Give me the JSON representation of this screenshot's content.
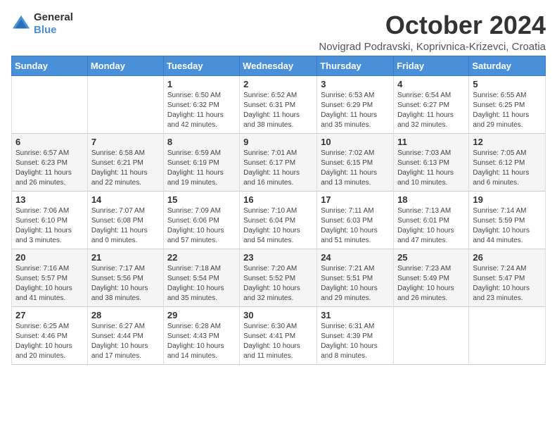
{
  "logo": {
    "general": "General",
    "blue": "Blue"
  },
  "header": {
    "month": "October 2024",
    "location": "Novigrad Podravski, Koprivnica-Krizevci, Croatia"
  },
  "weekdays": [
    "Sunday",
    "Monday",
    "Tuesday",
    "Wednesday",
    "Thursday",
    "Friday",
    "Saturday"
  ],
  "weeks": [
    [
      {
        "day": "",
        "info": ""
      },
      {
        "day": "",
        "info": ""
      },
      {
        "day": "1",
        "info": "Sunrise: 6:50 AM\nSunset: 6:32 PM\nDaylight: 11 hours and 42 minutes."
      },
      {
        "day": "2",
        "info": "Sunrise: 6:52 AM\nSunset: 6:31 PM\nDaylight: 11 hours and 38 minutes."
      },
      {
        "day": "3",
        "info": "Sunrise: 6:53 AM\nSunset: 6:29 PM\nDaylight: 11 hours and 35 minutes."
      },
      {
        "day": "4",
        "info": "Sunrise: 6:54 AM\nSunset: 6:27 PM\nDaylight: 11 hours and 32 minutes."
      },
      {
        "day": "5",
        "info": "Sunrise: 6:55 AM\nSunset: 6:25 PM\nDaylight: 11 hours and 29 minutes."
      }
    ],
    [
      {
        "day": "6",
        "info": "Sunrise: 6:57 AM\nSunset: 6:23 PM\nDaylight: 11 hours and 26 minutes."
      },
      {
        "day": "7",
        "info": "Sunrise: 6:58 AM\nSunset: 6:21 PM\nDaylight: 11 hours and 22 minutes."
      },
      {
        "day": "8",
        "info": "Sunrise: 6:59 AM\nSunset: 6:19 PM\nDaylight: 11 hours and 19 minutes."
      },
      {
        "day": "9",
        "info": "Sunrise: 7:01 AM\nSunset: 6:17 PM\nDaylight: 11 hours and 16 minutes."
      },
      {
        "day": "10",
        "info": "Sunrise: 7:02 AM\nSunset: 6:15 PM\nDaylight: 11 hours and 13 minutes."
      },
      {
        "day": "11",
        "info": "Sunrise: 7:03 AM\nSunset: 6:13 PM\nDaylight: 11 hours and 10 minutes."
      },
      {
        "day": "12",
        "info": "Sunrise: 7:05 AM\nSunset: 6:12 PM\nDaylight: 11 hours and 6 minutes."
      }
    ],
    [
      {
        "day": "13",
        "info": "Sunrise: 7:06 AM\nSunset: 6:10 PM\nDaylight: 11 hours and 3 minutes."
      },
      {
        "day": "14",
        "info": "Sunrise: 7:07 AM\nSunset: 6:08 PM\nDaylight: 11 hours and 0 minutes."
      },
      {
        "day": "15",
        "info": "Sunrise: 7:09 AM\nSunset: 6:06 PM\nDaylight: 10 hours and 57 minutes."
      },
      {
        "day": "16",
        "info": "Sunrise: 7:10 AM\nSunset: 6:04 PM\nDaylight: 10 hours and 54 minutes."
      },
      {
        "day": "17",
        "info": "Sunrise: 7:11 AM\nSunset: 6:03 PM\nDaylight: 10 hours and 51 minutes."
      },
      {
        "day": "18",
        "info": "Sunrise: 7:13 AM\nSunset: 6:01 PM\nDaylight: 10 hours and 47 minutes."
      },
      {
        "day": "19",
        "info": "Sunrise: 7:14 AM\nSunset: 5:59 PM\nDaylight: 10 hours and 44 minutes."
      }
    ],
    [
      {
        "day": "20",
        "info": "Sunrise: 7:16 AM\nSunset: 5:57 PM\nDaylight: 10 hours and 41 minutes."
      },
      {
        "day": "21",
        "info": "Sunrise: 7:17 AM\nSunset: 5:56 PM\nDaylight: 10 hours and 38 minutes."
      },
      {
        "day": "22",
        "info": "Sunrise: 7:18 AM\nSunset: 5:54 PM\nDaylight: 10 hours and 35 minutes."
      },
      {
        "day": "23",
        "info": "Sunrise: 7:20 AM\nSunset: 5:52 PM\nDaylight: 10 hours and 32 minutes."
      },
      {
        "day": "24",
        "info": "Sunrise: 7:21 AM\nSunset: 5:51 PM\nDaylight: 10 hours and 29 minutes."
      },
      {
        "day": "25",
        "info": "Sunrise: 7:23 AM\nSunset: 5:49 PM\nDaylight: 10 hours and 26 minutes."
      },
      {
        "day": "26",
        "info": "Sunrise: 7:24 AM\nSunset: 5:47 PM\nDaylight: 10 hours and 23 minutes."
      }
    ],
    [
      {
        "day": "27",
        "info": "Sunrise: 6:25 AM\nSunset: 4:46 PM\nDaylight: 10 hours and 20 minutes."
      },
      {
        "day": "28",
        "info": "Sunrise: 6:27 AM\nSunset: 4:44 PM\nDaylight: 10 hours and 17 minutes."
      },
      {
        "day": "29",
        "info": "Sunrise: 6:28 AM\nSunset: 4:43 PM\nDaylight: 10 hours and 14 minutes."
      },
      {
        "day": "30",
        "info": "Sunrise: 6:30 AM\nSunset: 4:41 PM\nDaylight: 10 hours and 11 minutes."
      },
      {
        "day": "31",
        "info": "Sunrise: 6:31 AM\nSunset: 4:39 PM\nDaylight: 10 hours and 8 minutes."
      },
      {
        "day": "",
        "info": ""
      },
      {
        "day": "",
        "info": ""
      }
    ]
  ]
}
